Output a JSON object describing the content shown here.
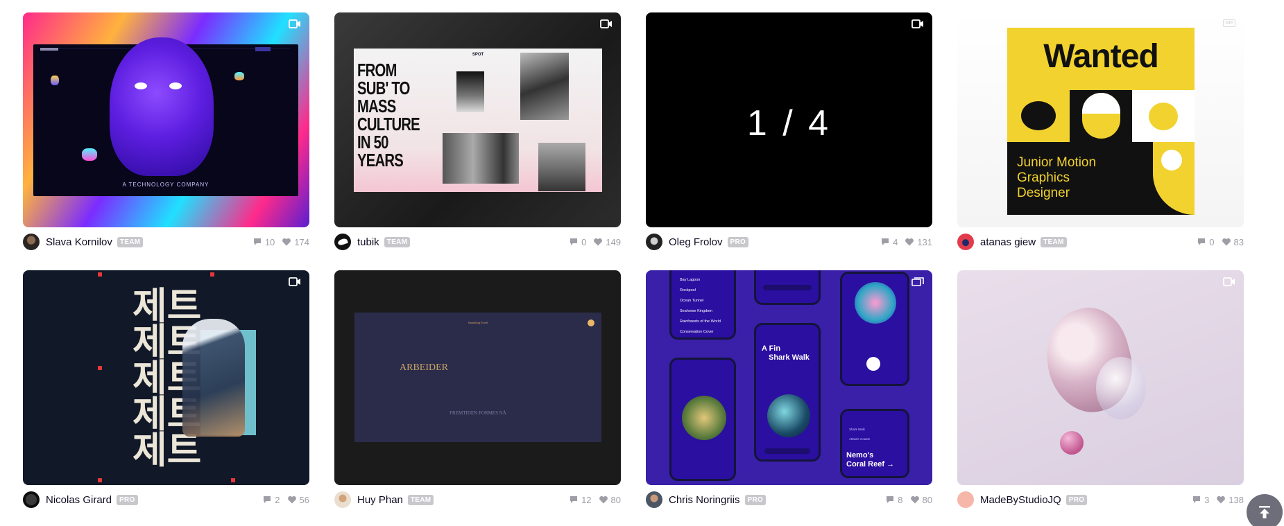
{
  "shots": [
    {
      "author": "Slava Kornilov",
      "badge": "TEAM",
      "comments": "10",
      "likes": "174",
      "media": "video-icon",
      "visual_text": {
        "center": "A TECHNOLOGY COMPANY"
      }
    },
    {
      "author": "tubik",
      "badge": "TEAM",
      "comments": "0",
      "likes": "149",
      "media": "video-icon",
      "visual_text": {
        "headline": [
          "FROM",
          "SUB' TO",
          "MASS",
          "CULTURE",
          "IN 50",
          "YEARS"
        ],
        "brand": "SPOT"
      }
    },
    {
      "author": "Oleg Frolov",
      "badge": "PRO",
      "comments": "4",
      "likes": "131",
      "media": "video-icon",
      "visual_text": {
        "counter": "1 / 4"
      }
    },
    {
      "author": "atanas giew",
      "badge": "TEAM",
      "comments": "0",
      "likes": "83",
      "media": "gif-icon",
      "media_label": "GIF",
      "visual_text": {
        "title": "Wanted",
        "subtitle": [
          "Junior Motion",
          "Graphics",
          "Designer"
        ]
      }
    },
    {
      "author": "Nicolas Girard",
      "badge": "PRO",
      "comments": "2",
      "likes": "56",
      "media": "video-icon",
      "visual_text": {
        "glyphs": [
          "제트",
          "제트",
          "제트",
          "제트",
          "제트"
        ]
      }
    },
    {
      "author": "Huy Phan",
      "badge": "TEAM",
      "comments": "12",
      "likes": "80",
      "media": "none",
      "visual_text": {
        "title": "ARBEIDER",
        "tagline": "FREMTIDEN FORMES NÅ",
        "top": "Smørklitag Forsel"
      }
    },
    {
      "author": "Chris Noringriis",
      "badge": "PRO",
      "comments": "8",
      "likes": "80",
      "media": "multi-shot-icon",
      "visual_text": {
        "list": [
          "Bay Lagoon",
          "Rockpool",
          "Ocean Tunnel",
          "Seahorse Kingdom",
          "Rainforests of the World",
          "Conservation Cover"
        ],
        "screen_title": [
          "A Fin",
          "Shark Walk"
        ],
        "card_title": [
          "Nemo's",
          "Coral Reef →"
        ],
        "menu": [
          "Shark Walk",
          "Atlantic Coasts"
        ]
      }
    },
    {
      "author": "MadeByStudioJQ",
      "badge": "PRO",
      "comments": "3",
      "likes": "138",
      "media": "video-icon",
      "visual_text": {}
    }
  ],
  "colors": {
    "badge": "#c8c8cc",
    "stat": "#9e9ea7",
    "author": "#0d0c22"
  }
}
